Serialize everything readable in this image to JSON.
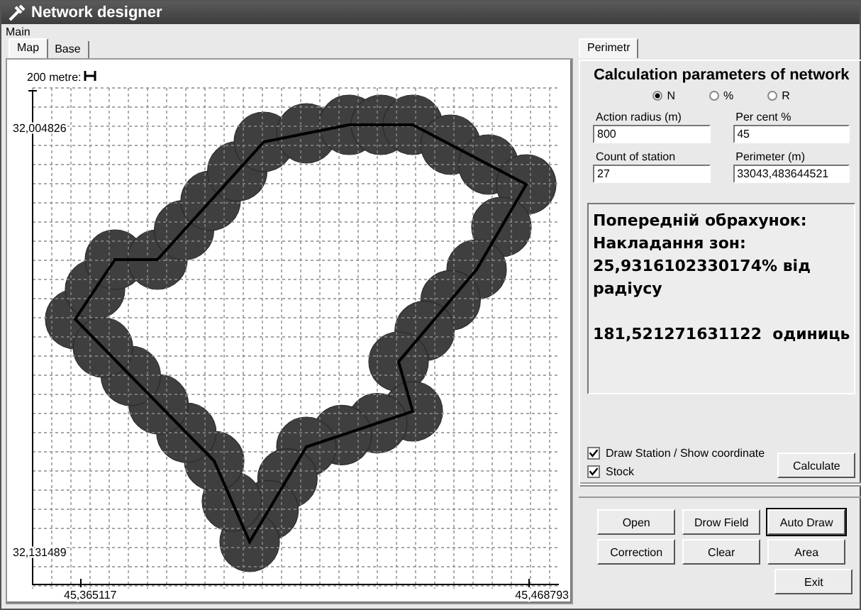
{
  "window": {
    "title": "Network designer"
  },
  "menu": [
    "Main"
  ],
  "left_tabs": [
    {
      "label": "Map",
      "selected": true
    },
    {
      "label": "Base",
      "selected": false
    }
  ],
  "map": {
    "scale_label": "200 metre:",
    "y_labels": [
      "32,004826",
      "32,131489"
    ],
    "x_labels": [
      "45,365117",
      "45,468793"
    ]
  },
  "right_tabs": [
    {
      "label": "Perimetr",
      "selected": true
    }
  ],
  "params": {
    "title": "Calculation parameters of network",
    "modes": [
      {
        "label": "N",
        "selected": true
      },
      {
        "label": "%",
        "selected": false
      },
      {
        "label": "R",
        "selected": false
      }
    ],
    "fields": [
      {
        "label": "Action radius (m)",
        "value": "800"
      },
      {
        "label": "Per cent  %",
        "value": "45"
      },
      {
        "label": "Count of station",
        "value": "27"
      },
      {
        "label": "Perimeter  (m)",
        "value": "33043,483644521"
      }
    ],
    "result": {
      "lines": [
        "Попередній обрахунок:",
        "Накладання зон:",
        "25,9316102330174% від радіусу"
      ],
      "total": "181,521271631122  одиниць"
    },
    "checkboxes": [
      {
        "label": "Draw Station / Show coordinate",
        "checked": true
      },
      {
        "label": "Stock",
        "checked": true
      }
    ],
    "calculate_button": "Calculate"
  },
  "button_rows": [
    [
      {
        "label": "Open",
        "focused": false
      },
      {
        "label": "Drow Field",
        "focused": false
      },
      {
        "label": "Auto Draw",
        "focused": true
      }
    ],
    [
      {
        "label": "Correction",
        "focused": false
      },
      {
        "label": "Clear",
        "focused": false
      },
      {
        "label": "Area",
        "focused": false
      }
    ],
    [
      {
        "label": "Exit",
        "focused": false
      }
    ]
  ]
}
